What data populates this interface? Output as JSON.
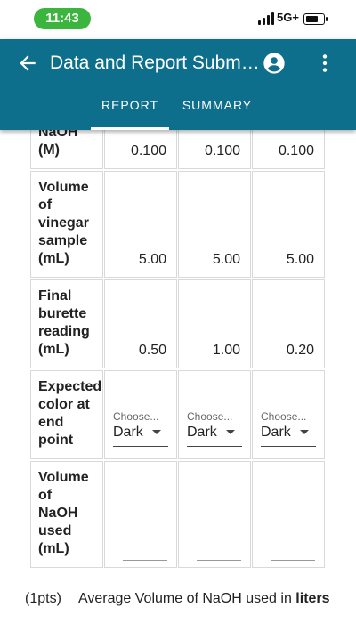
{
  "status_bar": {
    "time": "11:43",
    "network": "5G+"
  },
  "app_bar": {
    "title": "Data and Report Subm…",
    "tabs": [
      {
        "label": "REPORT",
        "active": true
      },
      {
        "label": "SUMMARY",
        "active": false
      }
    ],
    "color": "#0e6f8c"
  },
  "table": {
    "rows": [
      {
        "label": "NaOH\n(M)",
        "type": "value",
        "values": [
          "0.100",
          "0.100",
          "0.100"
        ]
      },
      {
        "label": "Volume\nof\nvinegar\nsample\n(mL)",
        "type": "value",
        "values": [
          "5.00",
          "5.00",
          "5.00"
        ]
      },
      {
        "label": "Final\nburette\nreading\n(mL)",
        "type": "value",
        "values": [
          "0.50",
          "1.00",
          "0.20"
        ]
      },
      {
        "label": "Expected\ncolor at\nend\npoint",
        "type": "select",
        "placeholder": "Choose...",
        "values": [
          "Dark",
          "Dark",
          "Dark"
        ]
      },
      {
        "label": "Volume\nof\nNaOH\nused\n(mL)",
        "type": "input",
        "values": [
          "",
          "",
          ""
        ]
      }
    ]
  },
  "question": {
    "points": "(1pts)",
    "text_prefix": "Average Volume of NaOH used in",
    "text_bold": "liters"
  }
}
